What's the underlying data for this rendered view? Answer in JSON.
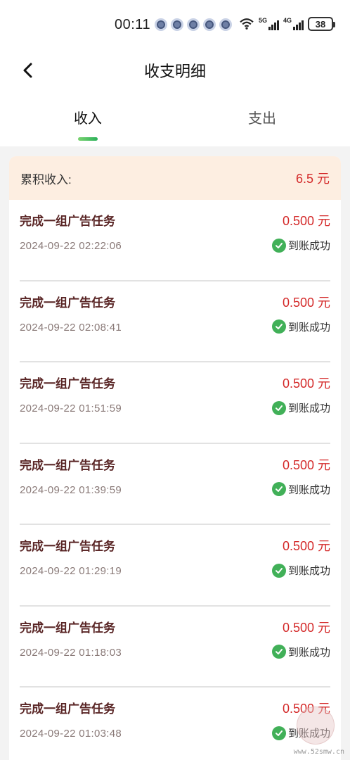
{
  "status_bar": {
    "time": "00:11",
    "network_1": "5G",
    "network_2": "4G",
    "battery": "38"
  },
  "header": {
    "title": "收支明细",
    "back_icon": "chevron-left-icon"
  },
  "tabs": [
    {
      "label": "收入",
      "active": true
    },
    {
      "label": "支出",
      "active": false
    }
  ],
  "summary": {
    "label": "累积收入:",
    "value": "6.5 元"
  },
  "records": [
    {
      "title": "完成一组广告任务",
      "amount": "0.500 元",
      "time": "2024-09-22 02:22:06",
      "status": "到账成功"
    },
    {
      "title": "完成一组广告任务",
      "amount": "0.500 元",
      "time": "2024-09-22 02:08:41",
      "status": "到账成功"
    },
    {
      "title": "完成一组广告任务",
      "amount": "0.500 元",
      "time": "2024-09-22 01:51:59",
      "status": "到账成功"
    },
    {
      "title": "完成一组广告任务",
      "amount": "0.500 元",
      "time": "2024-09-22 01:39:59",
      "status": "到账成功"
    },
    {
      "title": "完成一组广告任务",
      "amount": "0.500 元",
      "time": "2024-09-22 01:29:19",
      "status": "到账成功"
    },
    {
      "title": "完成一组广告任务",
      "amount": "0.500 元",
      "time": "2024-09-22 01:18:03",
      "status": "到账成功"
    },
    {
      "title": "完成一组广告任务",
      "amount": "0.500 元",
      "time": "2024-09-22 01:03:48",
      "status": "到账成功"
    }
  ],
  "watermark": {
    "text": "www.52smw.cn"
  },
  "colors": {
    "amount": "#d42a2a",
    "success": "#41b058",
    "summary_bg": "#fdeee1",
    "tab_indicator": "#2ab05a"
  }
}
